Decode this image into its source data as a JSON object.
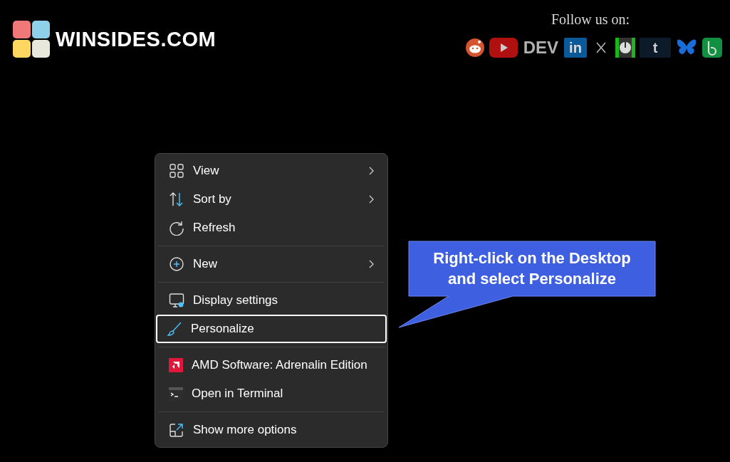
{
  "brand": {
    "name": "WINSIDES.COM"
  },
  "follow": {
    "title": "Follow us on:",
    "links": [
      {
        "kind": "reddit"
      },
      {
        "kind": "youtube"
      },
      {
        "kind": "dev",
        "label": "DEV"
      },
      {
        "kind": "linkedin",
        "label": "in"
      },
      {
        "kind": "x"
      },
      {
        "kind": "power"
      },
      {
        "kind": "tumblr",
        "label": "t"
      },
      {
        "kind": "butterfly"
      },
      {
        "kind": "b"
      }
    ]
  },
  "menu": {
    "groups": [
      {
        "items": [
          {
            "kind": "grid",
            "label": "View",
            "submenu": true,
            "selected": false
          },
          {
            "kind": "sort",
            "label": "Sort by",
            "submenu": true,
            "selected": false
          },
          {
            "kind": "refresh",
            "label": "Refresh",
            "submenu": false,
            "selected": false
          }
        ]
      },
      {
        "items": [
          {
            "kind": "plus",
            "label": "New",
            "submenu": true,
            "selected": false
          }
        ]
      },
      {
        "items": [
          {
            "kind": "display",
            "label": "Display settings",
            "submenu": false,
            "selected": false
          },
          {
            "kind": "brush",
            "label": "Personalize",
            "submenu": false,
            "selected": true
          }
        ]
      },
      {
        "items": [
          {
            "kind": "amd",
            "label": "AMD Software: Adrenalin Edition",
            "submenu": false,
            "selected": false
          },
          {
            "kind": "terminal",
            "label": "Open in Terminal",
            "submenu": false,
            "selected": false
          }
        ]
      },
      {
        "items": [
          {
            "kind": "more",
            "label": "Show more options",
            "submenu": false,
            "selected": false
          }
        ]
      }
    ]
  },
  "callout": {
    "lines": [
      "Right-click on the Desktop",
      "and select Personalize"
    ]
  }
}
